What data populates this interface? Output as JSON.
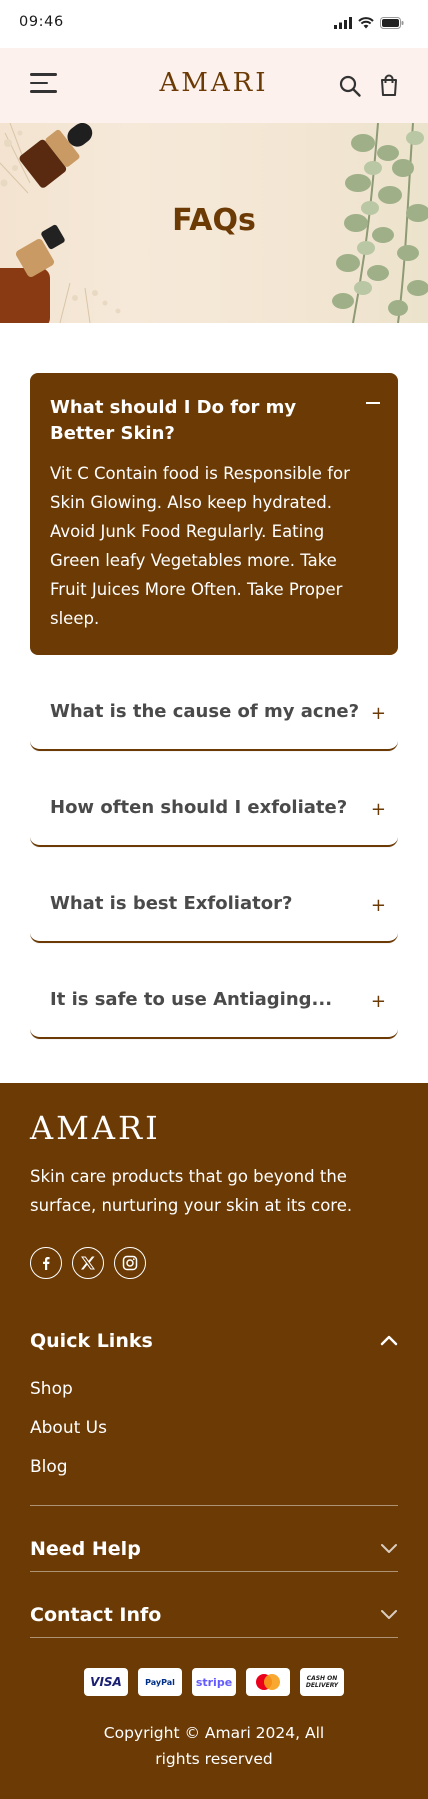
{
  "status": {
    "time": "09:46"
  },
  "header": {
    "brand": "AMARI"
  },
  "hero": {
    "title": "FAQs"
  },
  "faq": {
    "open_item": {
      "question": "What should I Do for my Better Skin?",
      "answer": "Vit C Contain food is Responsible for Skin Glowing. Also keep hydrated. Avoid Junk Food Regularly. Eating Green leafy Vegetables more. Take Fruit Juices More Often. Take Proper sleep.",
      "toggle": "−"
    },
    "items": [
      {
        "question": "What is the cause of my acne?",
        "toggle": "+"
      },
      {
        "question": "How often should I exfoliate?",
        "toggle": "+"
      },
      {
        "question": "What is best Exfoliator?",
        "toggle": "+"
      },
      {
        "question": "It is safe to use Antiaging...",
        "toggle": "+"
      }
    ]
  },
  "footer": {
    "logo": "AMARI",
    "description": "Skin care products that go beyond the surface, nurturing your skin at its core.",
    "socials": [
      "facebook-icon",
      "x-icon",
      "instagram-icon"
    ],
    "quick_links": {
      "title": "Quick Links",
      "links": [
        "Shop",
        "About Us",
        "Blog"
      ]
    },
    "need_help": {
      "title": "Need Help"
    },
    "contact_info": {
      "title": "Contact Info"
    },
    "payments": {
      "visa": "VISA",
      "paypal": "PayPal",
      "stripe": "stripe",
      "mastercard": "mastercard",
      "cod": "CASH ON DELIVERY"
    },
    "copyright_line1": "Copyright © Amari 2024, All",
    "copyright_line2": "rights reserved"
  },
  "colors": {
    "brand": "#6b3a05",
    "header_bg": "#fcf1ec"
  }
}
